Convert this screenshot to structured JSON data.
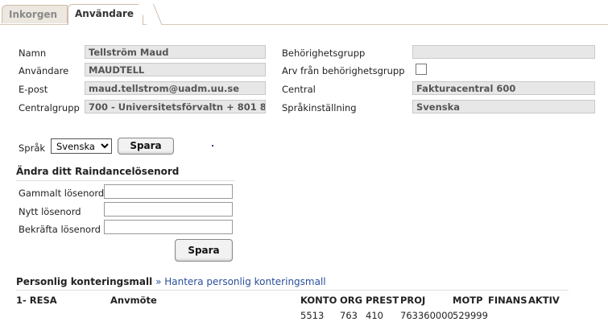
{
  "tabs": [
    {
      "label": "Inkorgen",
      "active": false
    },
    {
      "label": "Användare",
      "active": true
    }
  ],
  "user_fields": {
    "namn": {
      "label": "Namn",
      "value": "Tellström Maud"
    },
    "anvandare": {
      "label": "Användare",
      "value": "MAUDTELL"
    },
    "epost": {
      "label": "E-post",
      "value": "maud.tellstrom@uadm.uu.se"
    },
    "centralgrupp": {
      "label": "Centralgrupp",
      "value": "700 - Universitetsförvaltn + 801 8"
    },
    "behorighetsgrupp": {
      "label": "Behörighetsgrupp",
      "value": ""
    },
    "arv": {
      "label": "Arv från behörighetsgrupp",
      "checked": false
    },
    "central": {
      "label": "Central",
      "value": "Fakturacentral 600"
    },
    "sprakinstallning": {
      "label": "Språkinställning",
      "value": "Svenska"
    }
  },
  "language": {
    "label": "Språk",
    "selected": "Svenska",
    "save_label": "Spara"
  },
  "password": {
    "title": "Ändra ditt Raindancelösenord",
    "old_label": "Gammalt lösenord",
    "new_label": "Nytt lösenord",
    "confirm_label": "Bekräfta lösenord",
    "save_label": "Spara"
  },
  "template": {
    "title": "Personlig konteringsmall",
    "link": "» Hantera personlig konteringsmall",
    "row_name": "1- RESA",
    "row_desc": "Anvmöte",
    "headers": [
      "KONTO",
      "ORG",
      "PREST",
      "PROJ",
      "MOTP",
      "FINANS",
      "AKTIV"
    ],
    "values": {
      "konto": "5513",
      "org": "763",
      "prest": "410",
      "proj": "763360000",
      "motp": "529999"
    }
  }
}
